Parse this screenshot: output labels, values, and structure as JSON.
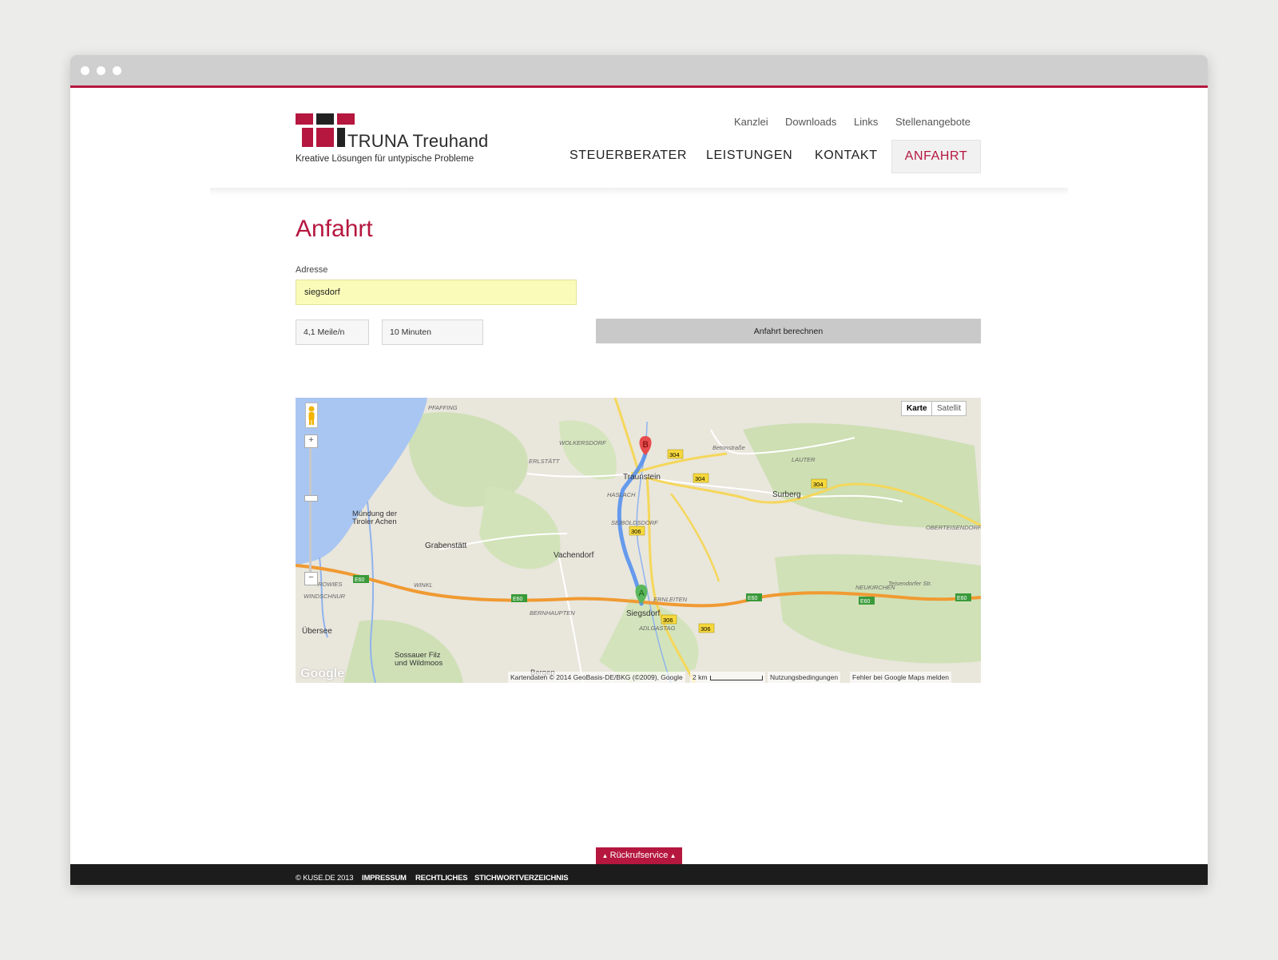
{
  "colors": {
    "accent": "#b5173f",
    "chrome": "#cfcfcf",
    "footer": "#1c1c1c",
    "address_bg": "#fbfbb9"
  },
  "logo": {
    "brand": "TRUNA Treuhand",
    "tagline": "Kreative Lösungen für untypische Probleme"
  },
  "subnav": [
    "Kanzlei",
    "Downloads",
    "Links",
    "Stellenangebote"
  ],
  "mainnav": [
    "STEUERBERATER",
    "LEISTUNGEN",
    "KONTAKT",
    "ANFAHRT"
  ],
  "active_nav": "ANFAHRT",
  "page": {
    "title": "Anfahrt"
  },
  "form": {
    "address_label": "Adresse",
    "address_value": "siegsdorf",
    "distance": "4,1 Meile/n",
    "duration": "10 Minuten",
    "calculate_label": "Anfahrt berechnen"
  },
  "map": {
    "types": [
      "Karte",
      "Satellit"
    ],
    "zoom_in": "+",
    "zoom_out": "−",
    "marker_a": "A",
    "marker_b": "B",
    "places": [
      "PFAFFING",
      "WOLKERSDORF",
      "ERLSTÄTT",
      "Traunstein",
      "HASLACH",
      "Surberg",
      "LAUTER",
      "OBERTEISENDORF",
      "Mündung der",
      "Tiroler Achen",
      "Grabenstätt",
      "Vachendorf",
      "SEIBOLDSDORF",
      "WINKL",
      "ROWIES",
      "WINDSCHNUR",
      "Übersee",
      "BERNHAUPTEN",
      "Siegsdorf",
      "ADLGASTAG",
      "ERNLEITEN",
      "NEUKIRCHEN",
      "Sossauer Filz",
      "und Wildmoos",
      "Bergen",
      "Betonstraße",
      "Teisendorfer Str."
    ],
    "road_shields": [
      "304",
      "304",
      "304",
      "306",
      "306",
      "306",
      "E60",
      "E60",
      "E60",
      "E60",
      "E60"
    ],
    "google": "Google",
    "attribution": "Kartendaten © 2014 GeoBasis-DE/BKG (©2009), Google",
    "scale": "2 km",
    "terms": "Nutzungsbedingungen",
    "report": "Fehler bei Google Maps melden"
  },
  "callback": "Rückrufservice",
  "footer": [
    "© KUSE.DE 2013",
    "IMPRESSUM",
    "RECHTLICHES",
    "STICHWORTVERZEICHNIS"
  ]
}
